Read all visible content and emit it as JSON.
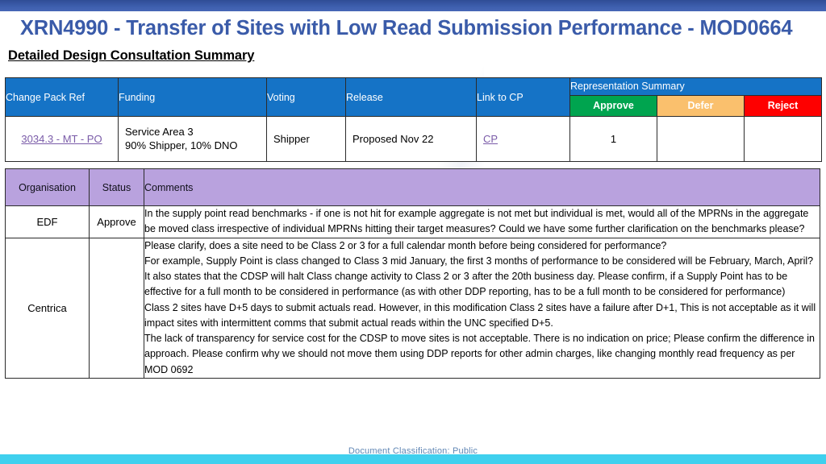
{
  "slide": {
    "title": "XRN4990 - Transfer of Sites with Low Read Submission Performance - MOD0664",
    "subtitle": "Detailed Design Consultation Summary",
    "footer_classification": "Document Classification: Public",
    "colors": {
      "title_blue": "#3a5ba9",
      "top_band": "#3a5ba9",
      "bottom_band": "#3fd0ee",
      "table_header_blue": "#1573c6",
      "comments_header_purple": "#b9a2de",
      "approve_green": "#00a44f",
      "defer_orange": "#fac06d",
      "reject_red": "#fe0000",
      "hyperlink_purple": "#7a5ba8"
    }
  },
  "summary_table": {
    "headers": {
      "change_pack_ref": "Change Pack Ref",
      "funding": "Funding",
      "voting": "Voting",
      "release": "Release",
      "link_to_cp": "Link to CP",
      "representation_summary": "Representation Summary",
      "approve": "Approve",
      "defer": "Defer",
      "reject": "Reject"
    },
    "row": {
      "change_pack_ref": "3034.3 - MT - PO",
      "funding_line1": "Service Area 3",
      "funding_line2": "90% Shipper, 10% DNO",
      "voting": "Shipper",
      "release": "Proposed Nov 22",
      "link_to_cp": "CP",
      "approve_count": "1",
      "defer_count": "",
      "reject_count": ""
    }
  },
  "comments_table": {
    "headers": {
      "organisation": "Organisation",
      "status": "Status",
      "comments": "Comments"
    },
    "rows": [
      {
        "organisation": "EDF",
        "status": "Approve",
        "comment_paragraphs": [
          "In the supply point read benchmarks - if one is not hit for example aggregate is not met but individual is met, would all of the MPRNs in the aggregate be moved class irrespective of individual MPRNs hitting their target measures? Could we have some further clarification on the benchmarks please?"
        ]
      },
      {
        "organisation": "Centrica",
        "status": "",
        "comment_paragraphs": [
          "Please clarify, does a site need to be Class 2 or 3 for a full calendar month before being considered for performance?",
          "For example, Supply Point is class changed to Class 3 mid January, the first 3 months of performance to be considered will be February, March, April?",
          "It also states that the CDSP will halt Class change activity to Class 2 or 3 after the 20th business day. Please confirm, if a Supply Point has to be effective for a full month to be considered in performance (as with other DDP reporting, has to be a full month to be considered for performance)",
          "Class 2 sites have D+5 days to submit actuals read. However, in this modification Class 2 sites have a failure after D+1, This is not acceptable as it will impact sites with intermittent comms that submit actual reads within the UNC specified D+5.",
          "The lack of transparency for service cost for the CDSP to move sites is not acceptable. There is no indication on price; Please confirm the difference in approach. Please confirm why we should not move them using DDP reports  for other admin charges, like changing monthly read frequency as per MOD 0692"
        ]
      }
    ]
  }
}
